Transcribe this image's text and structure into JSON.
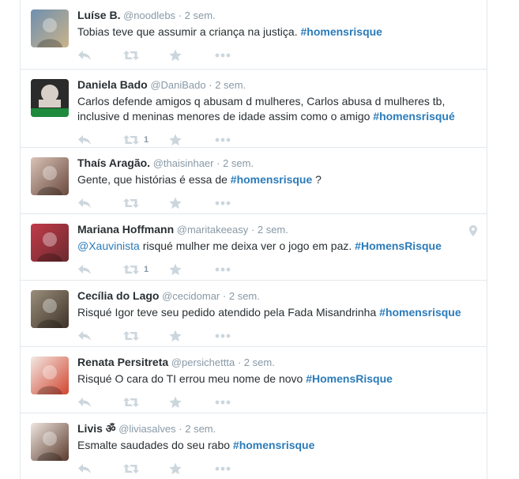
{
  "tweets": [
    {
      "name": "Luíse B.",
      "handle": "@noodlebs",
      "time": "2 sem.",
      "text_parts": [
        {
          "t": "Tobias teve que assumir a criança na justiça. "
        },
        {
          "h": "#homensrisque"
        }
      ],
      "retweet_count": "",
      "avatar": {
        "bg1": "#6f8fb0",
        "bg2": "#c9b38a"
      }
    },
    {
      "name": "Daniela Bado",
      "handle": "@DaniBado",
      "time": "2 sem.",
      "text_parts": [
        {
          "t": "Carlos defende amigos q abusam d mulheres, Carlos abusa d mulheres tb, inclusive d meninas menores de idade assim como o amigo "
        },
        {
          "h": "#homensrisqué"
        }
      ],
      "retweet_count": "1",
      "avatar": {
        "bg1": "#2b2b2b",
        "bg2": "#1e8a3c",
        "label": "ETHICKENO.GH"
      }
    },
    {
      "name": "Thaís Aragão.",
      "handle": "@thaisinhaer",
      "time": "2 sem.",
      "text_parts": [
        {
          "t": "Gente, que histórias é essa de "
        },
        {
          "h": "#homensrisque"
        },
        {
          "t": " ?"
        }
      ],
      "retweet_count": "",
      "avatar": {
        "bg1": "#d9c2b8",
        "bg2": "#6a4a3e"
      }
    },
    {
      "name": "Mariana Hoffmann",
      "handle": "@maritakeeasy",
      "time": "2 sem.",
      "text_parts": [
        {
          "m": "@Xauvinista"
        },
        {
          "t": " risqué mulher me deixa ver o jogo em paz. "
        },
        {
          "h": "#HomensRisque"
        }
      ],
      "retweet_count": "1",
      "has_geo": true,
      "avatar": {
        "bg1": "#c23a4a",
        "bg2": "#6b2a2f"
      }
    },
    {
      "name": "Cecília do Lago",
      "handle": "@cecidomar",
      "time": "2 sem.",
      "text_parts": [
        {
          "t": "Risqué Igor teve seu pedido atendido pela Fada Misandrinha "
        },
        {
          "h": "#homensrisque"
        }
      ],
      "retweet_count": "",
      "avatar": {
        "bg1": "#9a8f7c",
        "bg2": "#3e3328"
      }
    },
    {
      "name": "Renata Persitreta",
      "handle": "@persichettta",
      "time": "2 sem.",
      "text_parts": [
        {
          "t": "Risqué O cara do TI errou meu nome de novo "
        },
        {
          "h": "#HomensRisque"
        }
      ],
      "retweet_count": "",
      "avatar": {
        "bg1": "#f2e8e4",
        "bg2": "#d2462f"
      }
    },
    {
      "name": "Livis ॐ",
      "handle": "@liviasalves",
      "time": "2 sem.",
      "text_parts": [
        {
          "t": "Esmalte saudades do seu rabo "
        },
        {
          "h": "#homensrisque"
        }
      ],
      "retweet_count": "",
      "avatar": {
        "bg1": "#efe6e0",
        "bg2": "#5a3a2c"
      }
    }
  ],
  "separator": "·",
  "colors": {
    "hashtag": "#2b7bb9",
    "muted": "#8899a6",
    "icon": "#ccd6dd"
  },
  "icons": {
    "reply": "reply-icon",
    "retweet": "retweet-icon",
    "favorite": "star-icon",
    "more": "more-dots-icon",
    "geo": "location-pin-icon"
  }
}
